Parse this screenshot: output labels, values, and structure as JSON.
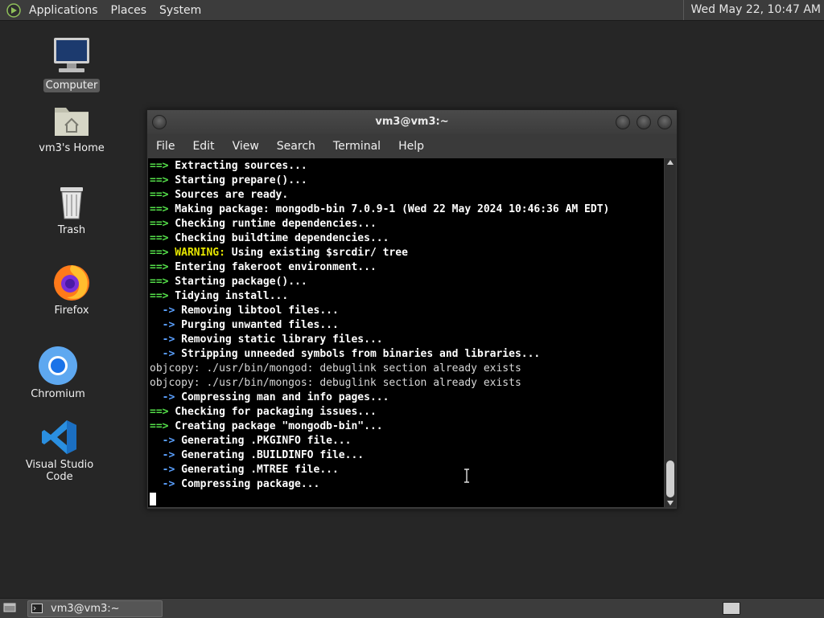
{
  "top_panel": {
    "menus": [
      "Applications",
      "Places",
      "System"
    ],
    "clock": "Wed May 22, 10:47 AM"
  },
  "desktop": {
    "icons": [
      {
        "label": "Computer",
        "icon": "computer-icon",
        "selected": true
      },
      {
        "label": "vm3's Home",
        "icon": "home-folder-icon"
      },
      {
        "label": "Trash",
        "icon": "trash-icon"
      },
      {
        "label": "Firefox",
        "icon": "firefox-icon"
      },
      {
        "label": "Chromium",
        "icon": "chromium-icon"
      },
      {
        "label": "Visual Studio Code",
        "icon": "vscode-icon"
      }
    ]
  },
  "terminal": {
    "title": "vm3@vm3:~",
    "menus": [
      "File",
      "Edit",
      "View",
      "Search",
      "Terminal",
      "Help"
    ],
    "lines": [
      {
        "prefix": "==>",
        "kind": "arrow",
        "text": " Extracting sources..."
      },
      {
        "prefix": "==>",
        "kind": "arrow",
        "text": " Starting prepare()..."
      },
      {
        "prefix": "==>",
        "kind": "arrow",
        "text": " Sources are ready."
      },
      {
        "prefix": "==>",
        "kind": "arrow",
        "text": " Making package: mongodb-bin 7.0.9-1 (Wed 22 May 2024 10:46:36 AM EDT)"
      },
      {
        "prefix": "==>",
        "kind": "arrow",
        "text": " Checking runtime dependencies..."
      },
      {
        "prefix": "==>",
        "kind": "arrow",
        "text": " Checking buildtime dependencies..."
      },
      {
        "prefix": "==>",
        "kind": "warn",
        "warn": " WARNING:",
        "text": " Using existing $srcdir/ tree"
      },
      {
        "prefix": "==>",
        "kind": "arrow",
        "text": " Entering fakeroot environment..."
      },
      {
        "prefix": "==>",
        "kind": "arrow",
        "text": " Starting package()..."
      },
      {
        "prefix": "==>",
        "kind": "arrow",
        "text": " Tidying install..."
      },
      {
        "prefix": "  ->",
        "kind": "sub",
        "text": " Removing libtool files..."
      },
      {
        "prefix": "  ->",
        "kind": "sub",
        "text": " Purging unwanted files..."
      },
      {
        "prefix": "  ->",
        "kind": "sub",
        "text": " Removing static library files..."
      },
      {
        "prefix": "  ->",
        "kind": "sub",
        "text": " Stripping unneeded symbols from binaries and libraries..."
      },
      {
        "prefix": "",
        "kind": "plain",
        "text": "objcopy: ./usr/bin/mongod: debuglink section already exists"
      },
      {
        "prefix": "",
        "kind": "plain",
        "text": "objcopy: ./usr/bin/mongos: debuglink section already exists"
      },
      {
        "prefix": "  ->",
        "kind": "sub",
        "text": " Compressing man and info pages..."
      },
      {
        "prefix": "==>",
        "kind": "arrow",
        "text": " Checking for packaging issues..."
      },
      {
        "prefix": "==>",
        "kind": "arrow",
        "text": " Creating package \"mongodb-bin\"..."
      },
      {
        "prefix": "  ->",
        "kind": "sub",
        "text": " Generating .PKGINFO file..."
      },
      {
        "prefix": "  ->",
        "kind": "sub",
        "text": " Generating .BUILDINFO file..."
      },
      {
        "prefix": "  ->",
        "kind": "sub",
        "text": " Generating .MTREE file..."
      },
      {
        "prefix": "  ->",
        "kind": "sub",
        "text": " Compressing package..."
      }
    ]
  },
  "bottom_panel": {
    "task_label": "vm3@vm3:~"
  },
  "colors": {
    "arrow": "#55e04a",
    "sub": "#5aa0ff",
    "warning": "#e6e600"
  }
}
